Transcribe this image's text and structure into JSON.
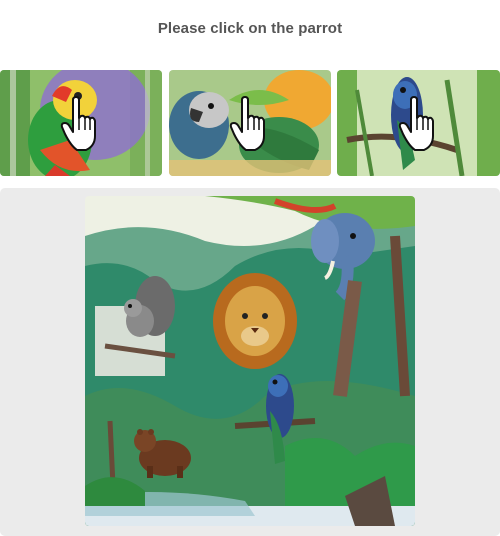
{
  "captcha": {
    "instruction": "Please click on the parrot",
    "examples": [
      {
        "subject": "parrot",
        "icon": "hand-pointer-icon"
      },
      {
        "subject": "parrot",
        "icon": "hand-pointer-icon"
      },
      {
        "subject": "parrot",
        "icon": "hand-pointer-icon"
      }
    ],
    "scene": {
      "subjects": [
        "squirrel",
        "lion",
        "elephant",
        "parrot",
        "bear"
      ],
      "style": "watercolor jungle"
    }
  },
  "colors": {
    "panel_bg": "#ebebeb",
    "instruction_text": "#555555"
  }
}
